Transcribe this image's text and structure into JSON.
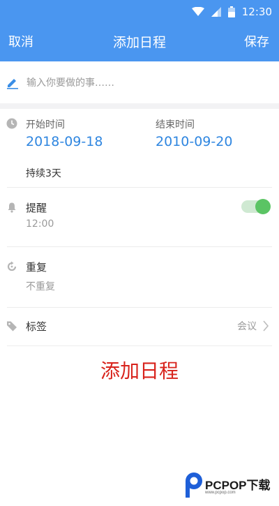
{
  "status_bar": {
    "time": "12:30",
    "icons": [
      "wifi-icon",
      "signal-icon",
      "battery-icon"
    ]
  },
  "header": {
    "cancel_label": "取消",
    "title": "添加日程",
    "save_label": "保存"
  },
  "task_input": {
    "placeholder": "输入你要做的事……",
    "value": ""
  },
  "schedule": {
    "start_label": "开始时间",
    "start_date": "2018-09-18",
    "end_label": "结束时间",
    "end_date": "2010-09-20",
    "duration": "持续3天"
  },
  "reminder": {
    "label": "提醒",
    "time": "12:00",
    "enabled": true
  },
  "repeat": {
    "label": "重复",
    "value": "不重复"
  },
  "tag": {
    "label": "标签",
    "value": "会议"
  },
  "overlay_caption": "添加日程",
  "watermark": {
    "brand": "PCPOP下载",
    "sub": "www.pcpop.com"
  },
  "colors": {
    "header_bg": "#4a96f0",
    "date_blue": "#2f86e0",
    "toggle_on": "#5bc464",
    "caption_red": "#d8231c"
  }
}
